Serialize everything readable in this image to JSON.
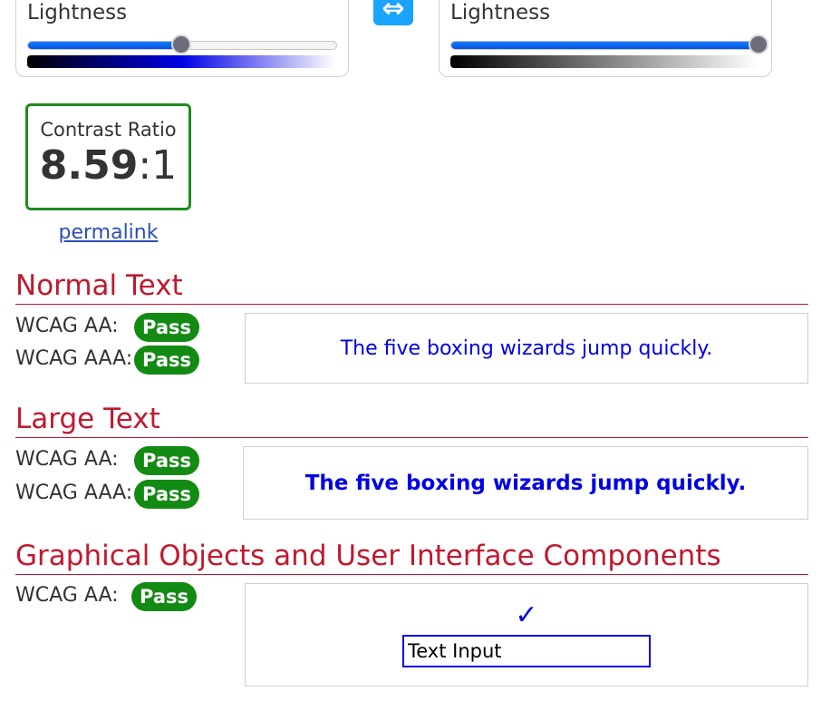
{
  "foreground": {
    "label": "Lightness",
    "lightness_fraction": 0.5
  },
  "background": {
    "label": "Lightness",
    "lightness_fraction": 1.0
  },
  "swap_icon": "double-arrow-icon",
  "contrast": {
    "label": "Contrast Ratio",
    "value": "8.59",
    "suffix": ":1"
  },
  "permalink": "permalink",
  "normal_text": {
    "title": "Normal Text",
    "aa_label": "WCAG AA:",
    "aa_result": "Pass",
    "aaa_label": "WCAG AAA:",
    "aaa_result": "Pass",
    "sample": "The five boxing wizards jump quickly."
  },
  "large_text": {
    "title": "Large Text",
    "aa_label": "WCAG AA:",
    "aa_result": "Pass",
    "aaa_label": "WCAG AAA:",
    "aaa_result": "Pass",
    "sample": "The five boxing wizards jump quickly."
  },
  "graphical": {
    "title": "Graphical Objects and User Interface Components",
    "aa_label": "WCAG AA:",
    "aa_result": "Pass",
    "checkmark": "✓",
    "input_value": "Text Input"
  },
  "colors": {
    "foreground": "#0000e6",
    "background": "#ffffff",
    "pass": "#138a13",
    "heading": "#c0192e"
  }
}
